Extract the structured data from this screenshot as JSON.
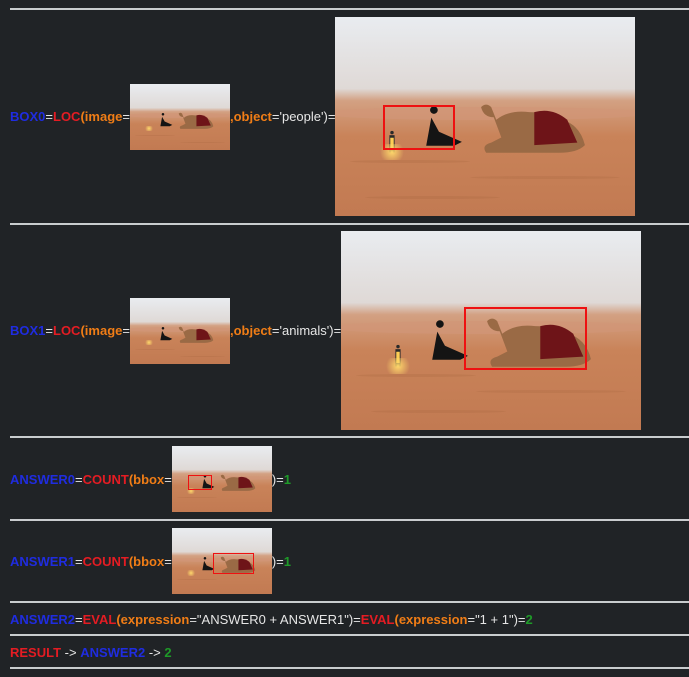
{
  "rows": [
    {
      "var": "BOX0",
      "eq": "=",
      "fn": "LOC",
      "open": "(",
      "arg1_name": "image",
      "arg1_eq": "=",
      "sep": ", ",
      "arg2_name": "object",
      "arg2_eq": "=",
      "arg2_value": "'people'",
      "close_eq": ")="
    },
    {
      "var": "BOX1",
      "eq": "=",
      "fn": "LOC",
      "open": "(",
      "arg1_name": "image",
      "arg1_eq": "=",
      "sep": ", ",
      "arg2_name": "object",
      "arg2_eq": "=",
      "arg2_value": "'animals'",
      "close_eq": ")="
    },
    {
      "var": "ANSWER0",
      "eq": "=",
      "fn": "COUNT",
      "open": "(",
      "arg1_name": "bbox",
      "arg1_eq": "=",
      "close_eq": ")=",
      "result": "1"
    },
    {
      "var": "ANSWER1",
      "eq": "=",
      "fn": "COUNT",
      "open": "(",
      "arg1_name": "bbox",
      "arg1_eq": "=",
      "close_eq": ")=",
      "result": "1"
    },
    {
      "var": "ANSWER2",
      "eq": "=",
      "fn": "EVAL",
      "open": "(",
      "arg1_name": "expression",
      "arg1_eq": "=",
      "arg1_value": "\"ANSWER0 + ANSWER1\"",
      "close_eq": ")=",
      "fn2": "EVAL",
      "open2": "(",
      "arg2_name": "expression",
      "arg2_eq": "=",
      "arg2_value": "\"1 + 1\"",
      "close_eq2": ")=",
      "result": "2"
    }
  ],
  "result_line": {
    "label": "RESULT",
    "arrow1": " -> ",
    "var": "ANSWER2",
    "arrow2": " -> ",
    "value": "2"
  },
  "colors": {
    "variable": "#1f2ce0",
    "function": "#e41c23",
    "argument": "#f07d16",
    "result": "#1e9a28",
    "bbox": "#ee1111",
    "background": "#202326"
  },
  "scene_elements": [
    "woman-sitting",
    "camel-resting",
    "lantern",
    "desert-dunes"
  ]
}
